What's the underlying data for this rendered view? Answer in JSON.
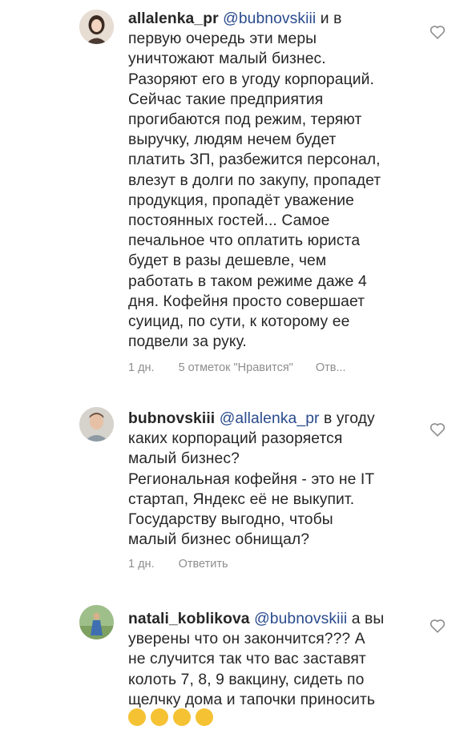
{
  "comments": [
    {
      "username": "allalenka_pr",
      "mention": "@bubnovskiii",
      "text_lines": [
        " и в",
        "первую очередь эти меры",
        "уничтожают малый бизнес.",
        "Разоряют его в угоду корпораций.",
        "Сейчас такие предприятия",
        "прогибаются под режим, теряют",
        "выручку, людям нечем будет",
        "платить ЗП, разбежится персонал,",
        "влезут в долги по закупу, пропадет",
        "продукция, пропадёт уважение",
        "постоянных гостей... Самое",
        "печальное что оплатить юриста",
        "будет в разы дешевле, чем",
        "работать в таком режиме даже 4",
        "дня. Кофейня просто совершает",
        "суицид, по сути, к которому ее",
        "подвели за руку."
      ],
      "time": "1 дн.",
      "likes": "5 отметок \"Нравится\"",
      "reply": "Отв..."
    },
    {
      "username": "bubnovskiii",
      "mention": "@allalenka_pr",
      "text_lines": [
        " в угоду",
        "каких корпораций разоряется",
        "малый бизнес?",
        "Региональная кофейня - это не IT",
        "стартап, Яндекс её не выкупит.",
        "Государству выгодно, чтобы",
        "малый бизнес обнищал?"
      ],
      "time": "1 дн.",
      "reply": "Ответить"
    },
    {
      "username": "natali_koblikova",
      "mention": "@bubnovskiii",
      "text_lines": [
        " а вы",
        "уверены что он закончится??? А",
        "не случится так что вас заставят",
        "колоть 7, 8, 9 вакцину, сидеть по",
        "щелчку дома и тапочки приносить"
      ]
    }
  ],
  "icons": {
    "like": "heart-outline-icon",
    "emoji": "grinning-sweat-emoji-icon"
  },
  "colors": {
    "text": "#262626",
    "mention": "#2a4b8d",
    "meta": "#8e8e8e"
  }
}
